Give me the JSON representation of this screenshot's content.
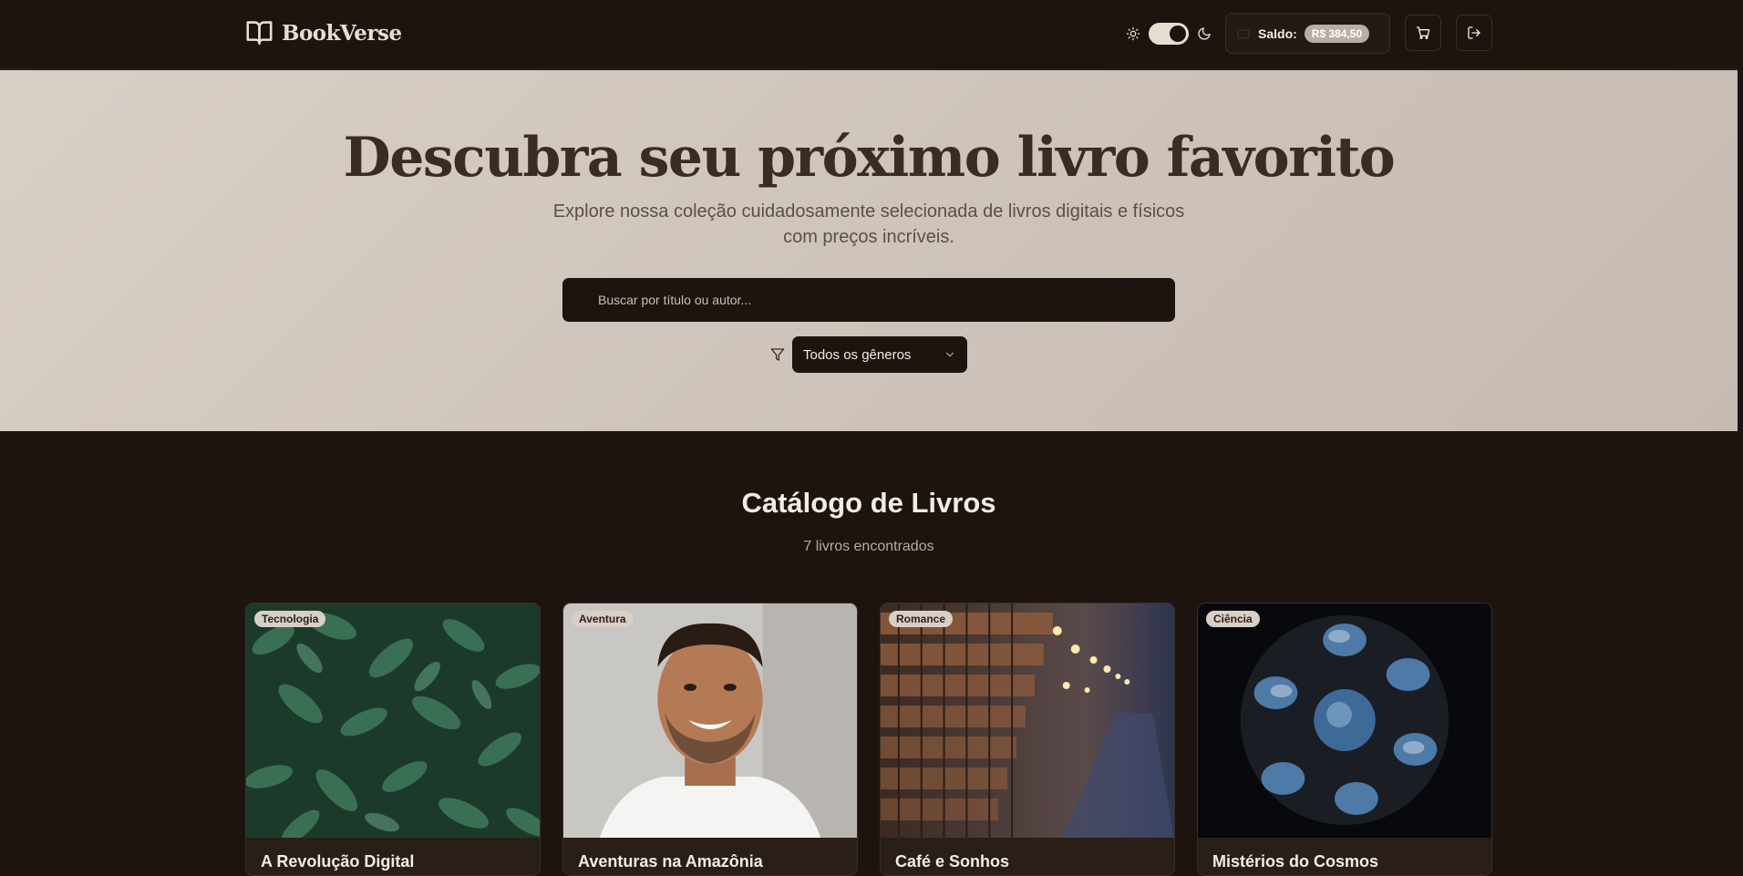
{
  "header": {
    "brand": "BookVerse",
    "balance_label": "Saldo:",
    "balance_value": "R$ 384,50"
  },
  "hero": {
    "title": "Descubra seu próximo livro favorito",
    "subtitle": "Explore nossa coleção cuidadosamente selecionada de livros digitais e físicos com preços incríveis.",
    "search_placeholder": "Buscar por título ou autor...",
    "genre_selected": "Todos os gêneros"
  },
  "catalog": {
    "title": "Catálogo de Livros",
    "count": "7 livros encontrados",
    "books": [
      {
        "genre": "Tecnologia",
        "title": "A Revolução Digital"
      },
      {
        "genre": "Aventura",
        "title": "Aventuras na Amazônia"
      },
      {
        "genre": "Romance",
        "title": "Café e Sonhos"
      },
      {
        "genre": "Ciência",
        "title": "Mistérios do Cosmos"
      }
    ]
  },
  "colors": {
    "background": "#1d140f",
    "hero_background": "#d4cac1",
    "accent": "#e7ddd2",
    "badge": "#d8cfc7"
  },
  "icons": [
    "book-open-icon",
    "sun-icon",
    "moon-icon",
    "wallet-icon",
    "cart-icon",
    "logout-icon",
    "search-icon",
    "filter-icon",
    "chevron-down-icon"
  ]
}
